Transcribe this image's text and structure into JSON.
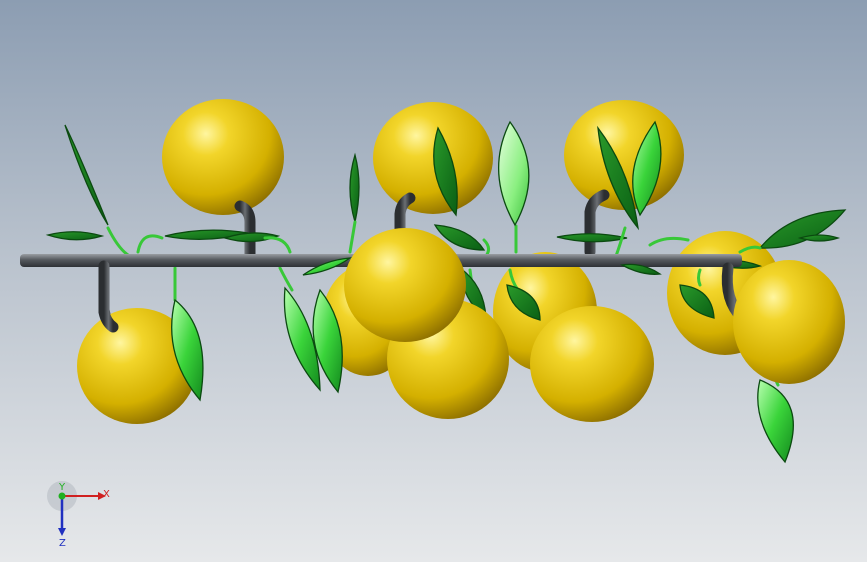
{
  "triad": {
    "x_label": "X",
    "y_label": "Y",
    "z_label": "Z",
    "colors": {
      "x": "#d02020",
      "y": "#20b020",
      "z": "#2030c0"
    }
  },
  "colors": {
    "fruit_light": "#fff6a0",
    "fruit_mid": "#e2c21a",
    "fruit_dark": "#a88400",
    "leaf_light": "#b8ffb0",
    "leaf_mid": "#3ad43a",
    "leaf_dark": "#0d7a1a",
    "rod_light": "#9a9ea3",
    "rod_dark": "#2e3135",
    "stem": "#3c3f43",
    "tendril": "#38c838"
  }
}
